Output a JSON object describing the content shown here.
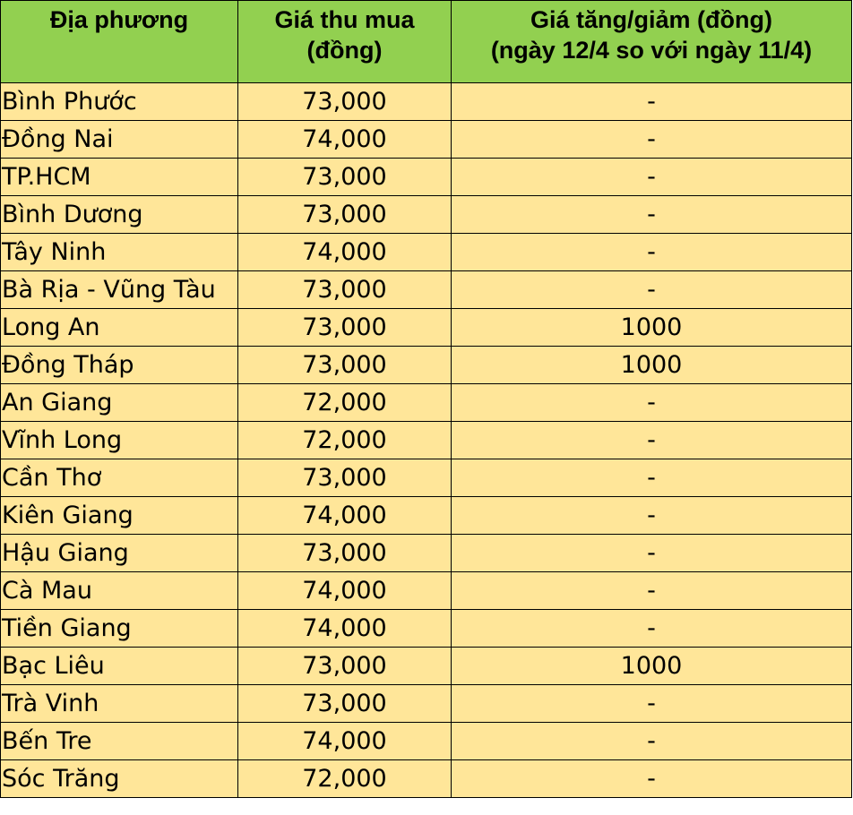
{
  "table": {
    "headers": [
      {
        "lines": [
          "Địa phương"
        ]
      },
      {
        "lines": [
          "Giá thu mua",
          "(đồng)"
        ]
      },
      {
        "lines": [
          "Giá tăng/giảm (đồng)",
          "(ngày 12/4 so với ngày 11/4)"
        ]
      }
    ],
    "rows": [
      {
        "name": "Bình Phước",
        "price": "73,000",
        "change": "-"
      },
      {
        "name": "Đồng Nai",
        "price": "74,000",
        "change": "-"
      },
      {
        "name": "TP.HCM",
        "price": "73,000",
        "change": "-"
      },
      {
        "name": "Bình Dương",
        "price": "73,000",
        "change": "-"
      },
      {
        "name": "Tây Ninh",
        "price": "74,000",
        "change": "-"
      },
      {
        "name": "Bà Rịa - Vũng Tàu",
        "price": "73,000",
        "change": "-"
      },
      {
        "name": "Long An",
        "price": "73,000",
        "change": "1000"
      },
      {
        "name": "Đồng Tháp",
        "price": "73,000",
        "change": "1000"
      },
      {
        "name": "An Giang",
        "price": "72,000",
        "change": "-"
      },
      {
        "name": "Vĩnh Long",
        "price": "72,000",
        "change": "-"
      },
      {
        "name": "Cần Thơ",
        "price": "73,000",
        "change": "-"
      },
      {
        "name": "Kiên Giang",
        "price": "74,000",
        "change": "-"
      },
      {
        "name": "Hậu Giang",
        "price": "73,000",
        "change": "-"
      },
      {
        "name": "Cà Mau",
        "price": "74,000",
        "change": "-"
      },
      {
        "name": "Tiền Giang",
        "price": "74,000",
        "change": "-"
      },
      {
        "name": "Bạc Liêu",
        "price": "73,000",
        "change": "1000"
      },
      {
        "name": "Trà Vinh",
        "price": "73,000",
        "change": "-"
      },
      {
        "name": "Bến Tre",
        "price": "74,000",
        "change": "-"
      },
      {
        "name": "Sóc Trăng",
        "price": "72,000",
        "change": "-"
      }
    ]
  },
  "colors": {
    "header_bg": "#92d050",
    "row_bg": "#ffe699",
    "border": "#000000"
  }
}
